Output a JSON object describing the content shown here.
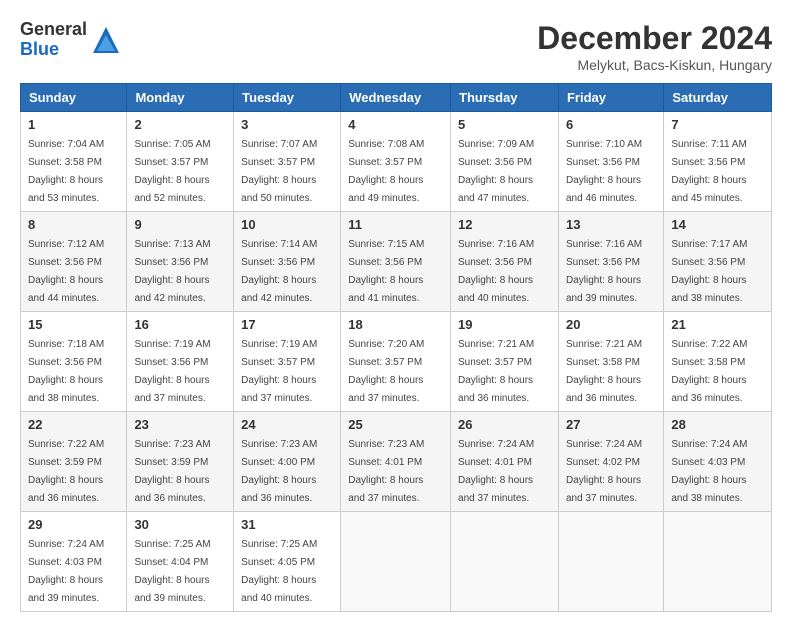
{
  "logo": {
    "general": "General",
    "blue": "Blue"
  },
  "title": "December 2024",
  "location": "Melykut, Bacs-Kiskun, Hungary",
  "headers": [
    "Sunday",
    "Monday",
    "Tuesday",
    "Wednesday",
    "Thursday",
    "Friday",
    "Saturday"
  ],
  "weeks": [
    [
      {
        "day": "1",
        "sunrise": "7:04 AM",
        "sunset": "3:58 PM",
        "daylight": "8 hours and 53 minutes."
      },
      {
        "day": "2",
        "sunrise": "7:05 AM",
        "sunset": "3:57 PM",
        "daylight": "8 hours and 52 minutes."
      },
      {
        "day": "3",
        "sunrise": "7:07 AM",
        "sunset": "3:57 PM",
        "daylight": "8 hours and 50 minutes."
      },
      {
        "day": "4",
        "sunrise": "7:08 AM",
        "sunset": "3:57 PM",
        "daylight": "8 hours and 49 minutes."
      },
      {
        "day": "5",
        "sunrise": "7:09 AM",
        "sunset": "3:56 PM",
        "daylight": "8 hours and 47 minutes."
      },
      {
        "day": "6",
        "sunrise": "7:10 AM",
        "sunset": "3:56 PM",
        "daylight": "8 hours and 46 minutes."
      },
      {
        "day": "7",
        "sunrise": "7:11 AM",
        "sunset": "3:56 PM",
        "daylight": "8 hours and 45 minutes."
      }
    ],
    [
      {
        "day": "8",
        "sunrise": "7:12 AM",
        "sunset": "3:56 PM",
        "daylight": "8 hours and 44 minutes."
      },
      {
        "day": "9",
        "sunrise": "7:13 AM",
        "sunset": "3:56 PM",
        "daylight": "8 hours and 42 minutes."
      },
      {
        "day": "10",
        "sunrise": "7:14 AM",
        "sunset": "3:56 PM",
        "daylight": "8 hours and 42 minutes."
      },
      {
        "day": "11",
        "sunrise": "7:15 AM",
        "sunset": "3:56 PM",
        "daylight": "8 hours and 41 minutes."
      },
      {
        "day": "12",
        "sunrise": "7:16 AM",
        "sunset": "3:56 PM",
        "daylight": "8 hours and 40 minutes."
      },
      {
        "day": "13",
        "sunrise": "7:16 AM",
        "sunset": "3:56 PM",
        "daylight": "8 hours and 39 minutes."
      },
      {
        "day": "14",
        "sunrise": "7:17 AM",
        "sunset": "3:56 PM",
        "daylight": "8 hours and 38 minutes."
      }
    ],
    [
      {
        "day": "15",
        "sunrise": "7:18 AM",
        "sunset": "3:56 PM",
        "daylight": "8 hours and 38 minutes."
      },
      {
        "day": "16",
        "sunrise": "7:19 AM",
        "sunset": "3:56 PM",
        "daylight": "8 hours and 37 minutes."
      },
      {
        "day": "17",
        "sunrise": "7:19 AM",
        "sunset": "3:57 PM",
        "daylight": "8 hours and 37 minutes."
      },
      {
        "day": "18",
        "sunrise": "7:20 AM",
        "sunset": "3:57 PM",
        "daylight": "8 hours and 37 minutes."
      },
      {
        "day": "19",
        "sunrise": "7:21 AM",
        "sunset": "3:57 PM",
        "daylight": "8 hours and 36 minutes."
      },
      {
        "day": "20",
        "sunrise": "7:21 AM",
        "sunset": "3:58 PM",
        "daylight": "8 hours and 36 minutes."
      },
      {
        "day": "21",
        "sunrise": "7:22 AM",
        "sunset": "3:58 PM",
        "daylight": "8 hours and 36 minutes."
      }
    ],
    [
      {
        "day": "22",
        "sunrise": "7:22 AM",
        "sunset": "3:59 PM",
        "daylight": "8 hours and 36 minutes."
      },
      {
        "day": "23",
        "sunrise": "7:23 AM",
        "sunset": "3:59 PM",
        "daylight": "8 hours and 36 minutes."
      },
      {
        "day": "24",
        "sunrise": "7:23 AM",
        "sunset": "4:00 PM",
        "daylight": "8 hours and 36 minutes."
      },
      {
        "day": "25",
        "sunrise": "7:23 AM",
        "sunset": "4:01 PM",
        "daylight": "8 hours and 37 minutes."
      },
      {
        "day": "26",
        "sunrise": "7:24 AM",
        "sunset": "4:01 PM",
        "daylight": "8 hours and 37 minutes."
      },
      {
        "day": "27",
        "sunrise": "7:24 AM",
        "sunset": "4:02 PM",
        "daylight": "8 hours and 37 minutes."
      },
      {
        "day": "28",
        "sunrise": "7:24 AM",
        "sunset": "4:03 PM",
        "daylight": "8 hours and 38 minutes."
      }
    ],
    [
      {
        "day": "29",
        "sunrise": "7:24 AM",
        "sunset": "4:03 PM",
        "daylight": "8 hours and 39 minutes."
      },
      {
        "day": "30",
        "sunrise": "7:25 AM",
        "sunset": "4:04 PM",
        "daylight": "8 hours and 39 minutes."
      },
      {
        "day": "31",
        "sunrise": "7:25 AM",
        "sunset": "4:05 PM",
        "daylight": "8 hours and 40 minutes."
      },
      null,
      null,
      null,
      null
    ]
  ],
  "labels": {
    "sunrise": "Sunrise:",
    "sunset": "Sunset:",
    "daylight": "Daylight hours"
  }
}
